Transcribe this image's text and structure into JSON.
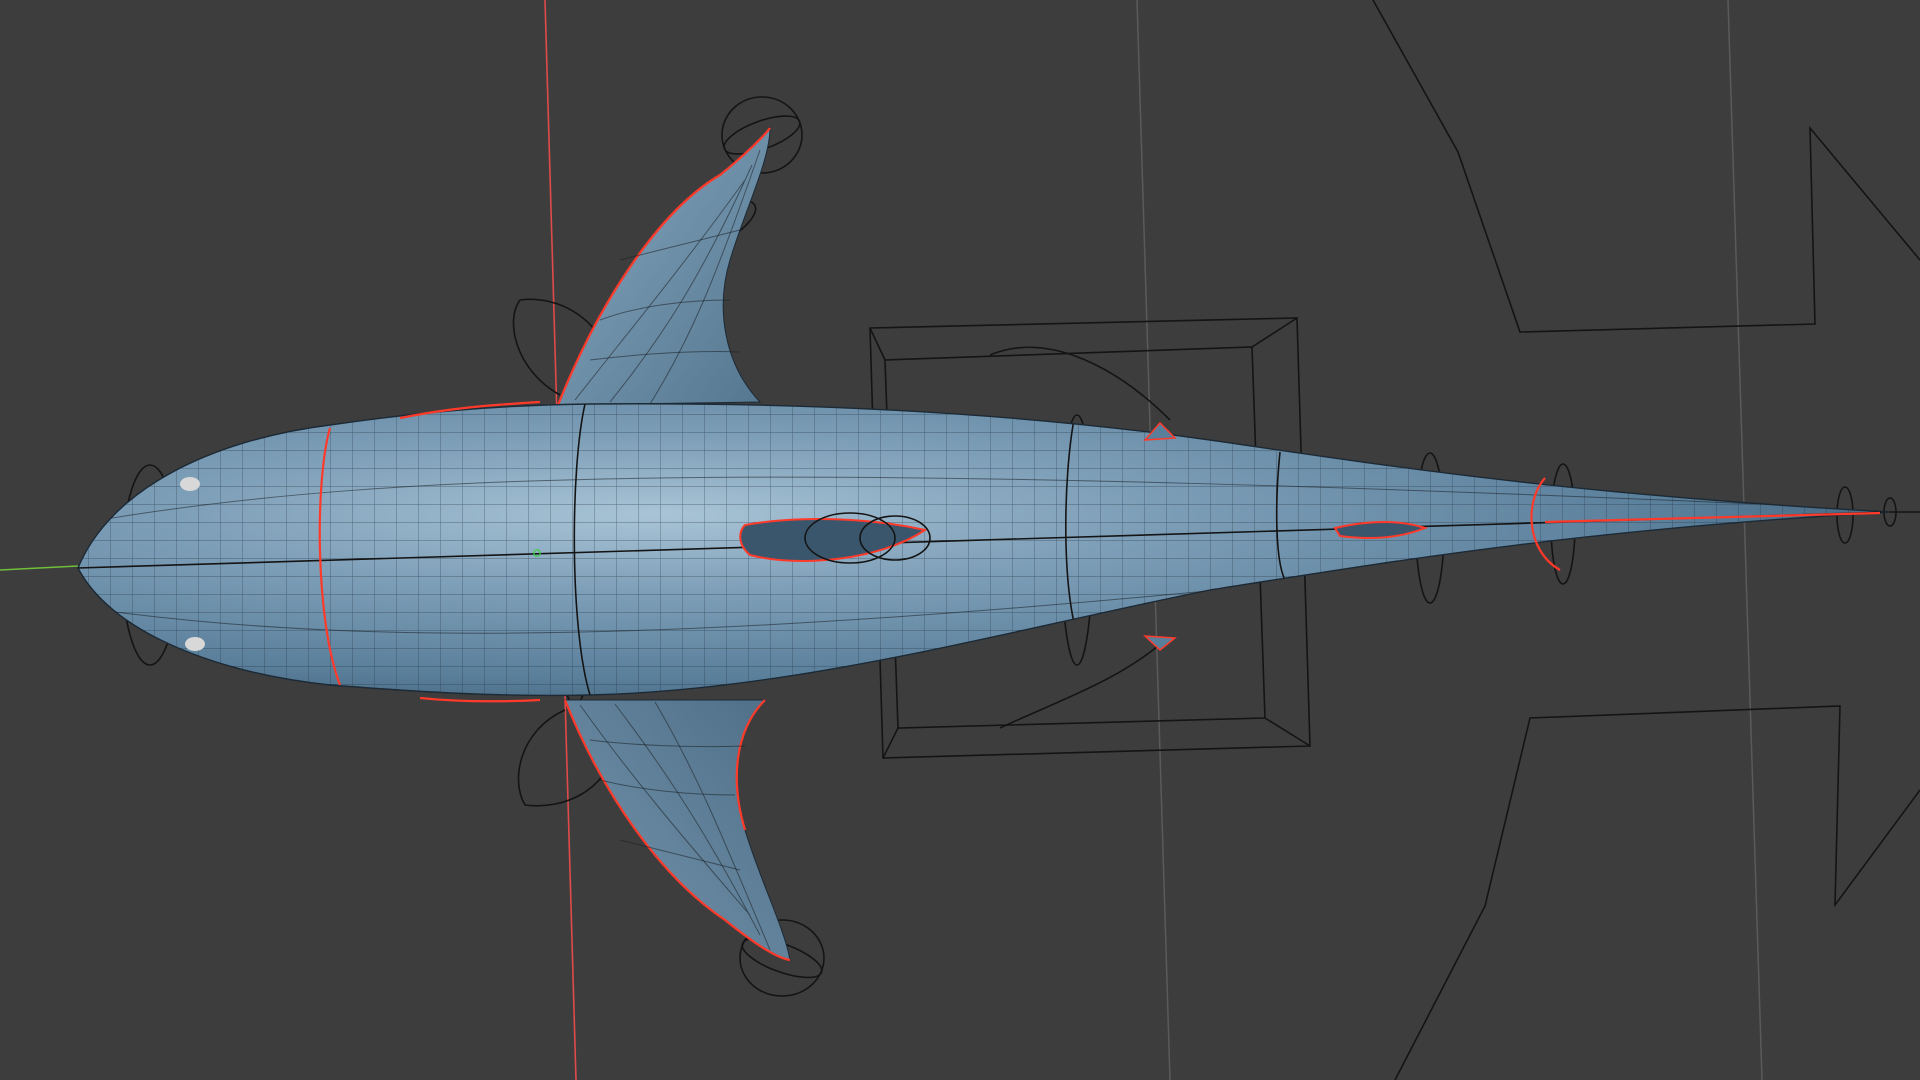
{
  "viewport": {
    "background": "#3d3d3d",
    "grid_color": "#5a5a5a",
    "axis_x_color": "#e04a4a",
    "axis_y_color": "#6fbf3a"
  },
  "model": {
    "body_color": "#5f86a4",
    "body_highlight": "#9cbbd0",
    "body_shadow": "#2f4a60",
    "seam_color": "#ff3a2a",
    "wire_color": "#141414",
    "origin_icon": "object-origin-icon"
  }
}
